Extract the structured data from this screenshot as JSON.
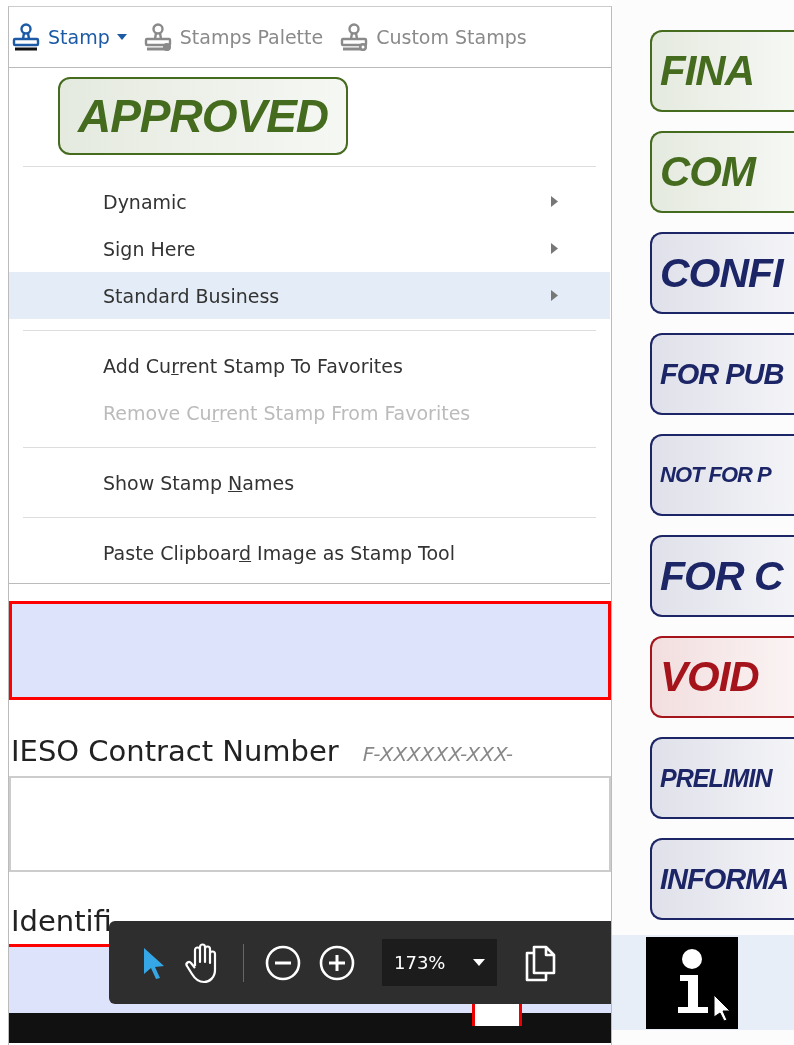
{
  "toolbar": {
    "items": [
      {
        "kind": "stamp",
        "label": "Stamp",
        "dropdown": true,
        "active": true
      },
      {
        "kind": "palette",
        "label": "Stamps Palette",
        "dropdown": false,
        "active": false
      },
      {
        "kind": "custom",
        "label": "Custom Stamps",
        "dropdown": false,
        "active": false
      }
    ]
  },
  "stamp_menu": {
    "current_stamp": {
      "text": "APPROVED",
      "color": "#456b1e"
    },
    "groups": [
      [
        {
          "label": "Dynamic",
          "submenu": true,
          "selected": false,
          "disabled": false
        },
        {
          "label": "Sign Here",
          "submenu": true,
          "selected": false,
          "disabled": false
        },
        {
          "label": "Standard Business",
          "submenu": true,
          "selected": true,
          "disabled": false
        }
      ],
      [
        {
          "label": "Add Cu",
          "access_key": "r",
          "label_after": "rent Stamp To Favorites",
          "submenu": false,
          "selected": false,
          "disabled": false
        },
        {
          "label": "Remove Cu",
          "access_key": "r",
          "label_after": "rent Stamp From Favorites",
          "submenu": false,
          "selected": false,
          "disabled": true
        }
      ],
      [
        {
          "label": "Show Stamp ",
          "access_key": "N",
          "label_after": "ames",
          "submenu": false,
          "selected": false,
          "disabled": false
        }
      ],
      [
        {
          "label": "Paste Clipboar",
          "access_key": "d",
          "label_after": " Image as Stamp Tool",
          "submenu": false,
          "selected": false,
          "disabled": false
        }
      ]
    ]
  },
  "form": {
    "contract_label": "IESO Contract Number",
    "contract_placeholder": "F-XXXXXX-XXX-",
    "identification_label": "Identifi"
  },
  "floating_toolbar": {
    "zoom": "173%"
  },
  "stamps": [
    {
      "text": "FINA",
      "color": "#456b1e"
    },
    {
      "text": "COM",
      "color": "#456b1e"
    },
    {
      "text": "CONFI",
      "color": "#1c2566"
    },
    {
      "text": "FOR PUB",
      "color": "#1c2566"
    },
    {
      "text": "NOT FOR P",
      "color": "#1c2566"
    },
    {
      "text": "FOR C",
      "color": "#1c2566"
    },
    {
      "text": "VOID",
      "color": "#a5141a"
    },
    {
      "text": "PRELIMIN",
      "color": "#1c2566"
    },
    {
      "text": "INFORMA",
      "color": "#1c2566"
    }
  ]
}
